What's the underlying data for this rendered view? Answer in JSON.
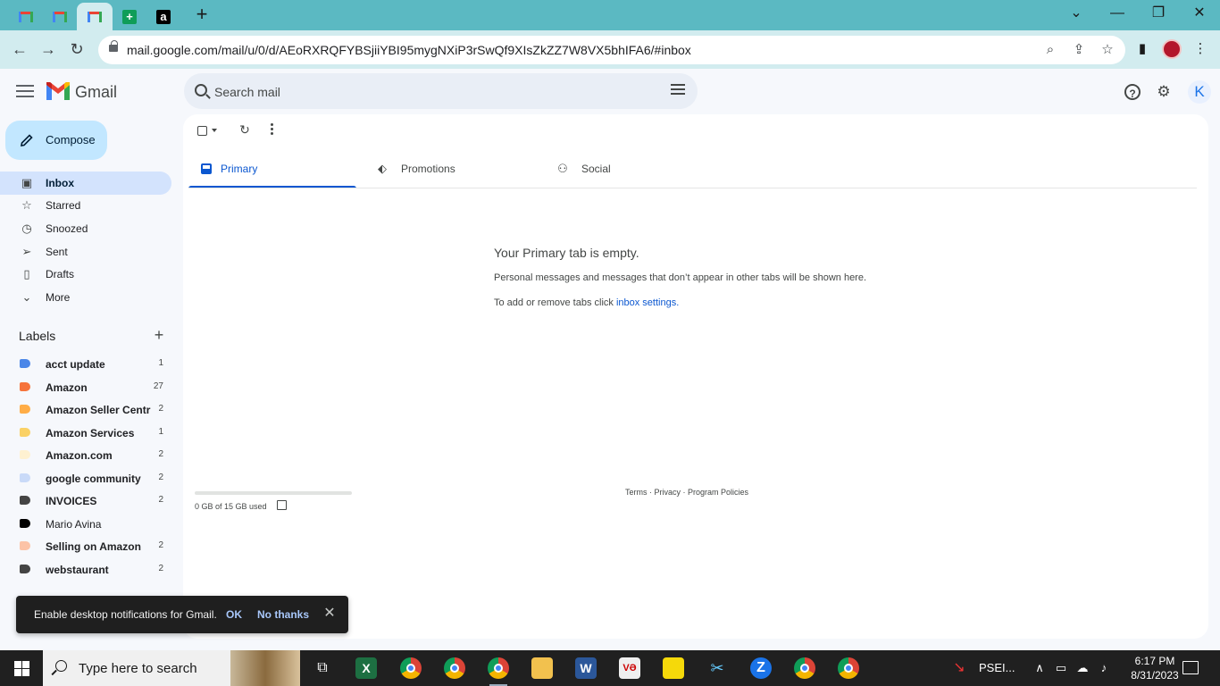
{
  "browser": {
    "url_host": "mail.google.com",
    "url_path": "/mail/u/0/d/AEoRXRQFYBSjiiYBI95mygNXiP3rSwQf9XIsZkZZ7W8VX5bhIFA6/#inbox",
    "new_tab_glyph": "+"
  },
  "gmail": {
    "app_name": "Gmail",
    "search_placeholder": "Search mail",
    "avatar_initial": "K",
    "compose_label": "Compose"
  },
  "nav": [
    {
      "label": "Inbox",
      "icon": "inbox-icon",
      "active": true
    },
    {
      "label": "Starred",
      "icon": "star-icon"
    },
    {
      "label": "Snoozed",
      "icon": "clock-icon"
    },
    {
      "label": "Sent",
      "icon": "send-icon"
    },
    {
      "label": "Drafts",
      "icon": "draft-icon"
    },
    {
      "label": "More",
      "icon": "chevron-down-icon"
    }
  ],
  "labels": {
    "heading": "Labels",
    "items": [
      {
        "name": "acct update",
        "count": "1",
        "color": "#4a86e8",
        "bold": true
      },
      {
        "name": "Amazon",
        "count": "27",
        "color": "#f6743b",
        "bold": true
      },
      {
        "name": "Amazon Seller Centr",
        "count": "2",
        "color": "#ffad47",
        "bold": true
      },
      {
        "name": "Amazon Services",
        "count": "1",
        "color": "#fad165",
        "bold": true
      },
      {
        "name": "Amazon.com",
        "count": "2",
        "color": "#fef1d1",
        "bold": true
      },
      {
        "name": "google community",
        "count": "2",
        "color": "#c9daf8",
        "bold": true
      },
      {
        "name": "INVOICES",
        "count": "2",
        "color": "#444444",
        "bold": true
      },
      {
        "name": "Mario Avina",
        "count": "",
        "color": "#000000",
        "bold": false
      },
      {
        "name": "Selling on Amazon",
        "count": "2",
        "color": "#fcc3a7",
        "bold": true
      },
      {
        "name": "webstaurant",
        "count": "2",
        "color": "#444444",
        "bold": true
      }
    ]
  },
  "inbox_tabs": [
    {
      "label": "Primary",
      "icon": "inbox-icon",
      "active": true
    },
    {
      "label": "Promotions",
      "icon": "tag-icon"
    },
    {
      "label": "Social",
      "icon": "people-icon"
    }
  ],
  "empty_state": {
    "title": "Your Primary tab is empty.",
    "line1": "Personal messages and messages that don’t appear in other tabs will be shown here.",
    "line2_prefix": "To add or remove tabs click ",
    "line2_link": "inbox settings."
  },
  "footer": {
    "storage": "0 GB of 15 GB used",
    "links": "Terms · Privacy · Program Policies"
  },
  "toast": {
    "message": "Enable desktop notifications for Gmail.",
    "ok": "OK",
    "no_thanks": "No thanks",
    "close": "✕"
  },
  "taskbar": {
    "search_text": "Type here to search",
    "stock_text": "PSEI...",
    "time": "6:17 PM",
    "date": "8/31/2023"
  }
}
